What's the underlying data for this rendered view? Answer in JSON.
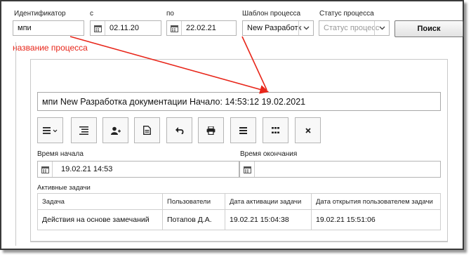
{
  "filters": {
    "id_label": "Идентификатор",
    "id_value": "мпи",
    "from_label": "с",
    "from_value": "02.11.20",
    "to_label": "по",
    "to_value": "22.02.21",
    "template_label": "Шаблон процесса",
    "template_value": "New Разработк",
    "status_label": "Статус процесса",
    "status_placeholder": "Статус процесс",
    "search_button": "Поиск"
  },
  "annotation": {
    "text": "название процесса",
    "color": "#e8261a"
  },
  "process": {
    "title": "мпи New Разработка документации Начало: 14:53:12 19.02.2021",
    "start_label": "Время начала",
    "start_value": "19.02.21 14:53",
    "end_label": "Время окончания",
    "end_value": ""
  },
  "toolbar": {
    "icons": [
      "menu-dropdown-icon",
      "list-icon",
      "add-user-icon",
      "document-icon",
      "undo-icon",
      "print-icon",
      "lines-icon",
      "grid-icon",
      "close-icon"
    ]
  },
  "tasks": {
    "section_label": "Активные задачи",
    "columns": [
      "Задача",
      "Пользователи",
      "Дата активации задачи",
      "Дата открытия пользователем задачи"
    ],
    "rows": [
      [
        "Действия на основе замечаний",
        "Потапов Д.А.",
        "19.02.21 15:04:38",
        "19.02.21 15:51:06"
      ]
    ]
  }
}
